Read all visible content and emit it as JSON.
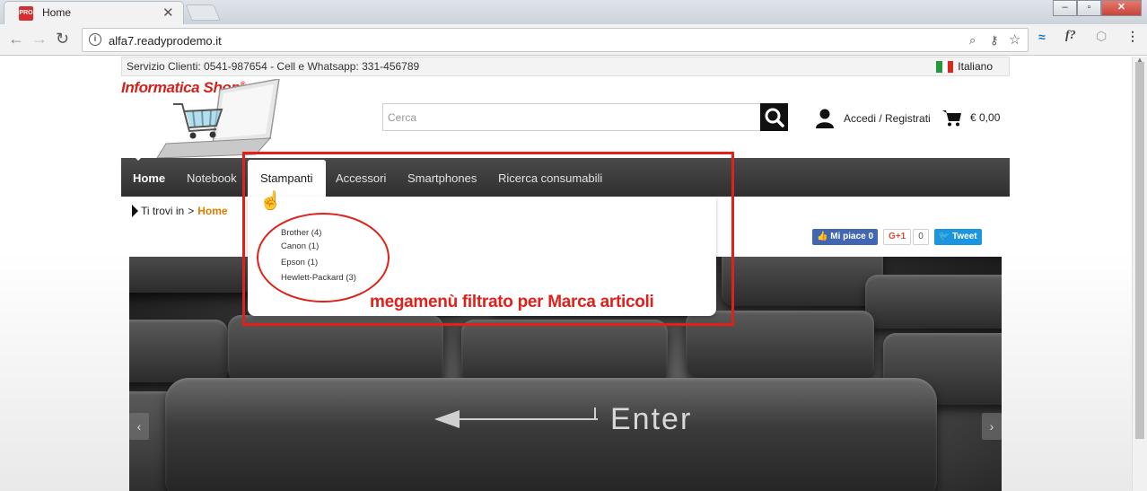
{
  "browser": {
    "tab_title": "Home",
    "favicon_label": "PRO",
    "url": "alfa7.readyprodemo.it"
  },
  "infobar": {
    "text": "Servizio Clienti: 0541-987654 - Cell e Whatsapp: 331-456789",
    "language": "Italiano"
  },
  "header": {
    "logo_text": "Informatica Shop",
    "logo_mark": "®",
    "search_placeholder": "Cerca",
    "login_label": "Accedi / Registrati",
    "cart_total": "€ 0,00"
  },
  "nav": {
    "items": [
      {
        "label": "Home"
      },
      {
        "label": "Notebook"
      },
      {
        "label": "Stampanti"
      },
      {
        "label": "Accessori"
      },
      {
        "label": "Smartphones"
      },
      {
        "label": "Ricerca consumabili"
      }
    ]
  },
  "breadcrumb": {
    "prefix": "Ti trovi in",
    "separator": ">",
    "current": "Home"
  },
  "megamenu": {
    "items": [
      {
        "label": "Brother (4)"
      },
      {
        "label": "Canon (1)"
      },
      {
        "label": "Epson (1)"
      },
      {
        "label": "Hewlett-Packard (3)"
      }
    ]
  },
  "social": {
    "fb_label": "Mi piace 0",
    "gplus_label": "G+1",
    "gplus_count": "0",
    "tweet_label": "Tweet"
  },
  "hero": {
    "key_label": "Enter"
  },
  "annotation": {
    "text": "megamenù filtrato per Marca articoli",
    "color": "#e0211b"
  }
}
